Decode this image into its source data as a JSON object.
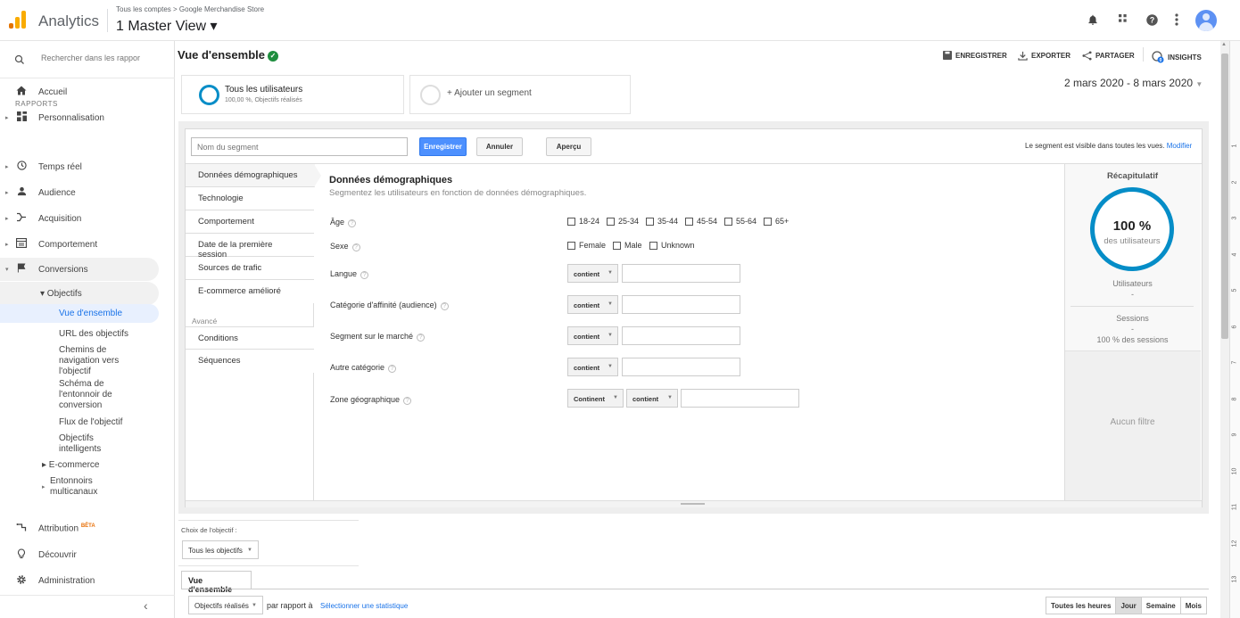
{
  "topbar": {
    "app_name": "Analytics",
    "breadcrumb": "Tous les comptes > Google Merchandise Store",
    "view_name": "1 Master View ▾",
    "brand_colors": [
      "#f9ab00",
      "#e37400"
    ]
  },
  "sidebar": {
    "search_placeholder": "Rechercher dans les rappor",
    "accueil": "Accueil",
    "personnalisation": "Personnalisation",
    "section": "RAPPORTS",
    "temps_reel": "Temps réel",
    "audience": "Audience",
    "acquisition": "Acquisition",
    "comportement": "Comportement",
    "conversions": "Conversions",
    "objectifs": "▾ Objectifs",
    "vue_ensemble": "Vue d'ensemble",
    "url_objectifs": "URL des objectifs",
    "chemins": "Chemins de navigation vers l'objectif",
    "schema": "Schéma de l'entonnoir de conversion",
    "flux": "Flux de l'objectif",
    "intelligents": "Objectifs intelligents",
    "ecommerce": "▸ E-commerce",
    "entonnoirs": "Entonnoirs multicanaux",
    "attribution": "Attribution",
    "beta": "BÊTA",
    "decouvrir": "Découvrir",
    "administration": "Administration",
    "collapse": "‹"
  },
  "header": {
    "title": "Vue d'ensemble",
    "enregistrer": "ENREGISTRER",
    "exporter": "EXPORTER",
    "partager": "PARTAGER",
    "insights": "INSIGHTS",
    "date_range": "2 mars 2020 - 8 mars 2020"
  },
  "segments": {
    "seg1_title": "Tous les utilisateurs",
    "seg1_sub": "100,00 %, Objectifs réalisés",
    "add": "+ Ajouter un segment"
  },
  "builder": {
    "name_placeholder": "Nom du segment",
    "save": "Enregistrer",
    "cancel": "Annuler",
    "preview": "Aperçu",
    "visible_note": "Le segment est visible dans toutes les vues.",
    "modify": "Modifier",
    "tabs": [
      "Données démographiques",
      "Technologie",
      "Comportement",
      "Date de la première session",
      "Sources de trafic",
      "E-commerce amélioré"
    ],
    "advanced_label": "Avancé",
    "adv_tabs": [
      "Conditions",
      "Séquences"
    ],
    "section_title": "Données démographiques",
    "section_sub": "Segmentez les utilisateurs en fonction de données démographiques.",
    "age_label": "Âge",
    "age_options": [
      "18-24",
      "25-34",
      "35-44",
      "45-54",
      "55-64",
      "65+"
    ],
    "sex_label": "Sexe",
    "sex_options": [
      "Female",
      "Male",
      "Unknown"
    ],
    "langue": "Langue",
    "affinite": "Catégorie d'affinité (audience)",
    "marche": "Segment sur le marché",
    "autre": "Autre catégorie",
    "zone": "Zone géographique",
    "contient": "contient",
    "continent": "Continent",
    "help": "?"
  },
  "summary": {
    "title": "Récapitulatif",
    "pct": "100 %",
    "of_users": "des utilisateurs",
    "users_label": "Utilisateurs",
    "users_val": "-",
    "sessions_label": "Sessions",
    "sessions_val": "-",
    "sessions_pct": "100 % des sessions",
    "no_filter": "Aucun filtre"
  },
  "bottom": {
    "goal_label": "Choix de l'objectif :",
    "goal_value": "Tous les objectifs",
    "tab": "Vue d'ensemble",
    "metric": "Objectifs réalisés",
    "vs": "par rapport à",
    "select_metric": "Sélectionner une statistique",
    "periods": [
      "Toutes les heures",
      "Jour",
      "Semaine",
      "Mois"
    ]
  },
  "ruler": [
    "1",
    "2",
    "3",
    "4",
    "5",
    "6",
    "7",
    "8",
    "9",
    "10",
    "11",
    "12",
    "13"
  ]
}
